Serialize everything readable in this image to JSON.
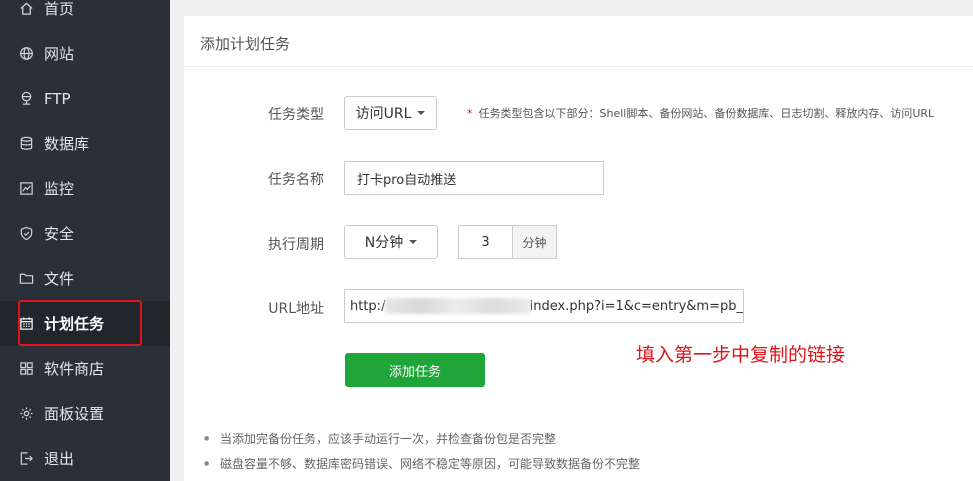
{
  "sidebar": {
    "items": [
      {
        "label": "首页",
        "icon": "home-icon"
      },
      {
        "label": "网站",
        "icon": "globe-icon"
      },
      {
        "label": "FTP",
        "icon": "ftp-icon"
      },
      {
        "label": "数据库",
        "icon": "database-icon"
      },
      {
        "label": "监控",
        "icon": "monitor-icon"
      },
      {
        "label": "安全",
        "icon": "shield-icon"
      },
      {
        "label": "文件",
        "icon": "folder-icon"
      },
      {
        "label": "计划任务",
        "icon": "calendar-icon",
        "active": true
      },
      {
        "label": "软件商店",
        "icon": "apps-icon"
      },
      {
        "label": "面板设置",
        "icon": "gear-icon"
      },
      {
        "label": "退出",
        "icon": "logout-icon"
      }
    ]
  },
  "page": {
    "title": "添加计划任务"
  },
  "form": {
    "task_type_label": "任务类型",
    "task_type_value": "访问URL",
    "task_type_hint_star": "*",
    "task_type_hint": "任务类型包含以下部分：Shell脚本、备份网站、备份数据库、日志切割、释放内存、访问URL",
    "task_name_label": "任务名称",
    "task_name_value": "打卡pro自动推送",
    "period_label": "执行周期",
    "period_value": "N分钟",
    "minutes_value": "3",
    "minutes_unit": "分钟",
    "url_label": "URL地址",
    "url_prefix": "http:/",
    "url_suffix": "index.php?i=1&c=entry&m=pb_",
    "submit_label": "添加任务"
  },
  "annotation": "填入第一步中复制的链接",
  "tips": [
    "当添加完备份任务，应该手动运行一次，并检查备份包是否完整",
    "磁盘容量不够、数据库密码错误、网络不稳定等原因，可能导致数据备份不完整"
  ],
  "colors": {
    "sidebar_bg": "#293038",
    "accent_green": "#20a53a",
    "annotation_red": "#e0141a"
  }
}
